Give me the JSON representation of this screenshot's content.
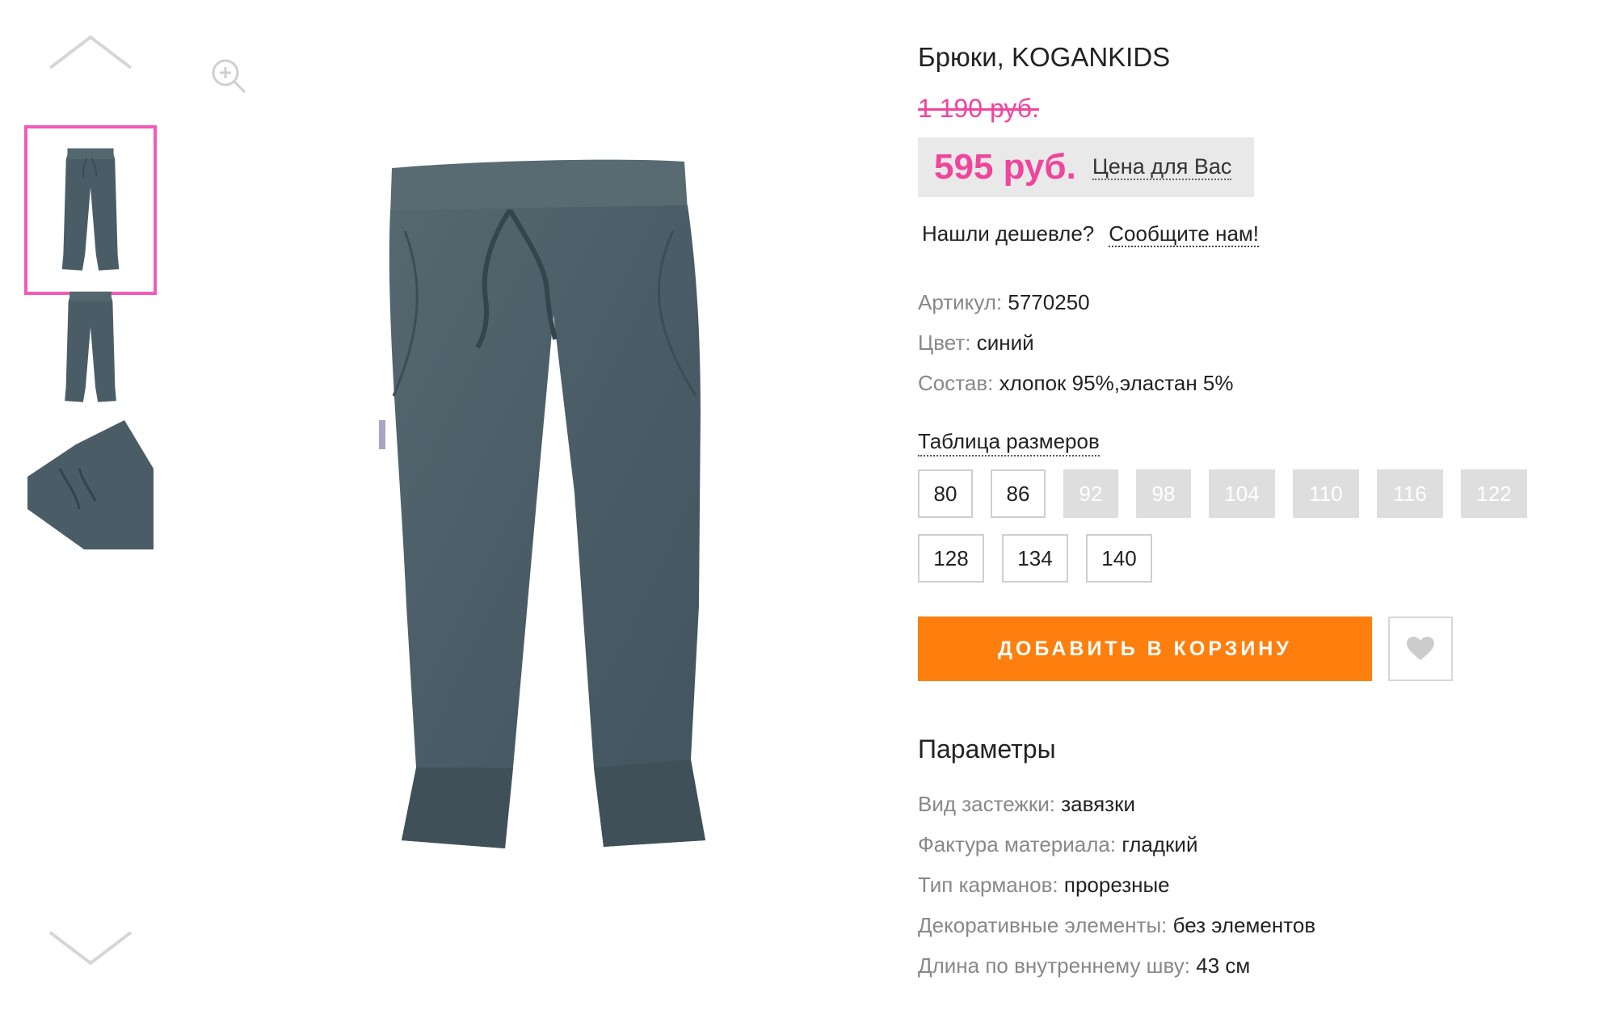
{
  "gallery": {
    "thumbnails": [
      {
        "view": "front",
        "selected": true
      },
      {
        "view": "back",
        "selected": false
      },
      {
        "view": "detail",
        "selected": false
      }
    ],
    "icons": {
      "prev": "chevron-up-icon",
      "next": "chevron-down-icon",
      "zoom": "zoom-in-icon"
    },
    "accent_color": "#f25ab8"
  },
  "product": {
    "title": "Брюки, KOGANKIDS",
    "old_price": "1 190 руб.",
    "price": "595 руб.",
    "price_note": "Цена для Вас",
    "cheaper_question": "Нашли дешевле?",
    "cheaper_link": "Сообщите нам!",
    "properties": [
      {
        "key": "Артикул:",
        "value": "5770250"
      },
      {
        "key": "Цвет:",
        "value": "синий"
      },
      {
        "key": "Состав:",
        "value": "хлопок 95%,эластан 5%"
      }
    ],
    "size_table_label": "Таблица размеров",
    "sizes": [
      {
        "label": "80",
        "available": true
      },
      {
        "label": "86",
        "available": true
      },
      {
        "label": "92",
        "available": false
      },
      {
        "label": "98",
        "available": false
      },
      {
        "label": "104",
        "available": false
      },
      {
        "label": "110",
        "available": false
      },
      {
        "label": "116",
        "available": false
      },
      {
        "label": "122",
        "available": false
      },
      {
        "label": "128",
        "available": true
      },
      {
        "label": "134",
        "available": true
      },
      {
        "label": "140",
        "available": true
      }
    ],
    "add_to_cart": "ДОБАВИТЬ В КОРЗИНУ",
    "wishlist_icon": "heart-icon",
    "params_title": "Параметры",
    "params": [
      {
        "key": "Вид застежки:",
        "value": "завязки"
      },
      {
        "key": "Фактура материала:",
        "value": "гладкий"
      },
      {
        "key": "Тип карманов:",
        "value": "прорезные"
      },
      {
        "key": "Декоративные элементы:",
        "value": "без элементов"
      },
      {
        "key": "Длина по внутреннему шву:",
        "value": "43 см"
      }
    ],
    "colors": {
      "price": "#f0459c",
      "cart_button": "#ff7f0e",
      "unavailable_size": "#dedede",
      "pants": "#4a5d67"
    }
  }
}
